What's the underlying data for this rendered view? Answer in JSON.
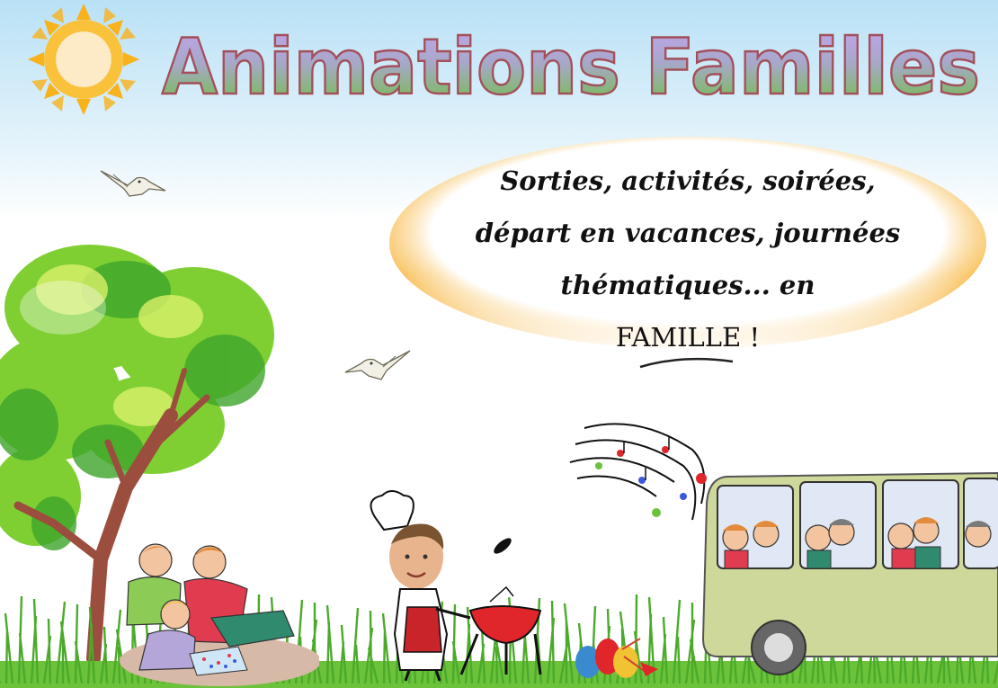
{
  "header": {
    "title": "Animations Familles"
  },
  "bubble": {
    "line1": "Sorties, activités, soirées,",
    "line2": "départ en vacances, journées",
    "line3": "thématiques... en",
    "line4": "FAMILLE !"
  },
  "colors": {
    "sky_top": "#bfe3f7",
    "title_fill_top": "#b79be6",
    "title_fill_bottom": "#7cc24a",
    "title_stroke": "#a85a5a",
    "bubble_orange": "#f7b23a",
    "grass": "#5cb82e",
    "bus": "#cdd89a"
  },
  "icons": [
    "sun-icon",
    "dove-icon",
    "tree-icon",
    "music-notes-icon",
    "bus-icon",
    "barbecue-icon",
    "easter-eggs-icon"
  ]
}
